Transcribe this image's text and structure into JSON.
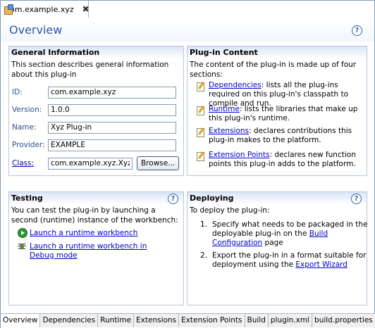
{
  "editor_tab": {
    "title": "com.example.xyz",
    "close": "✖"
  },
  "header": {
    "title": "Overview",
    "help": "?"
  },
  "general": {
    "title": "General Information",
    "description": "This section describes general information about this plug-in",
    "fields": {
      "id": {
        "label": "ID:",
        "value": "com.example.xyz"
      },
      "version": {
        "label": "Version:",
        "value": "1.0.0"
      },
      "name": {
        "label": "Name:",
        "value": "Xyz Plug-in"
      },
      "provider": {
        "label": "Provider:",
        "value": "EXAMPLE"
      },
      "class": {
        "label": "Class:",
        "value": "com.example.xyz.XyzP"
      }
    },
    "browse_label": "Browse..."
  },
  "plugin_content": {
    "title": "Plug-in Content",
    "description": "The content of the plug-in is made up of four sections:",
    "items": [
      {
        "link": "Dependencies",
        "text": ": lists all the plug-ins required on this plug-in's classpath to compile and run."
      },
      {
        "link": "Runtime",
        "text": ": lists the libraries that make up this plug-in's runtime."
      },
      {
        "link": "Extensions",
        "text": ": declares contributions this plug-in makes to the platform."
      },
      {
        "link": "Extension Points",
        "text": ": declares new function points this plug-in adds to the platform."
      }
    ]
  },
  "testing": {
    "title": "Testing",
    "help": "?",
    "description": "You can test the plug-in by launching a second (runtime) instance of the workbench:",
    "run_label": "Launch a runtime workbench",
    "debug_label": "Launch a runtime workbench in Debug mode"
  },
  "deploying": {
    "title": "Deploying",
    "help": "?",
    "description": "To deploy the plug-in:",
    "steps": [
      {
        "num": "1.",
        "pre": "Specify what needs to be packaged in the deployable plug-in on the ",
        "link": "Build Configuration",
        "post": " page"
      },
      {
        "num": "2.",
        "pre": "Export the plug-in in a format suitable for deployment using the ",
        "link": "Export Wizard",
        "post": ""
      }
    ]
  },
  "bottom_tabs": [
    "Overview",
    "Dependencies",
    "Runtime",
    "Extensions",
    "Extension Points",
    "Build",
    "plugin.xml",
    "build.properties"
  ],
  "colors": {
    "accent": "#2a5aa0",
    "link": "#0000c8",
    "section_border": "#b8c6da"
  }
}
